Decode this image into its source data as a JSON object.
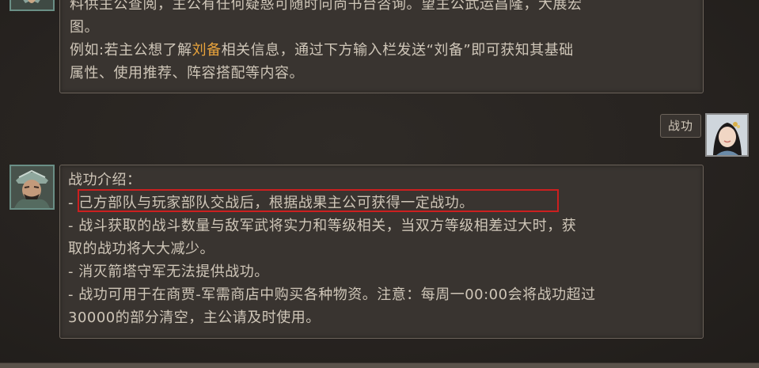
{
  "messages": [
    {
      "sender": "advisor",
      "lines": [
        "料供主公查阅，主公有任何疑惑可随时向尚书台咨询。望主公武运昌隆，大展宏",
        "图。"
      ],
      "example_prefix": "例如:若主公想了解",
      "example_highlight": "刘备",
      "example_suffix": "相关信息，通过下方输入栏发送“刘备”即可获知其基础",
      "example_line2": "属性、使用推荐、阵容搭配等内容。"
    },
    {
      "sender": "user",
      "text": "战功"
    },
    {
      "sender": "advisor",
      "lines": [
        "战功介绍：",
        "- 己方部队与玩家部队交战后，根据战果主公可获得一定战功。",
        "- 战斗获取的战斗数量与敌军武将实力和等级相关，当双方等级相差过大时，获",
        "取的战功将大大减少。",
        "- 消灭箭塔守军无法提供战功。",
        "- 战功可用于在商贾-军需商店中购买各种物资。注意：每周一00:00会将战功超过",
        "30000的部分清空，主公请及时使用。"
      ]
    }
  ],
  "colors": {
    "background": "#272320",
    "bubble": "#393430",
    "text": "#cfc6b8",
    "highlight": "#e8a33c",
    "annotation_box": "#cc1f1f"
  }
}
